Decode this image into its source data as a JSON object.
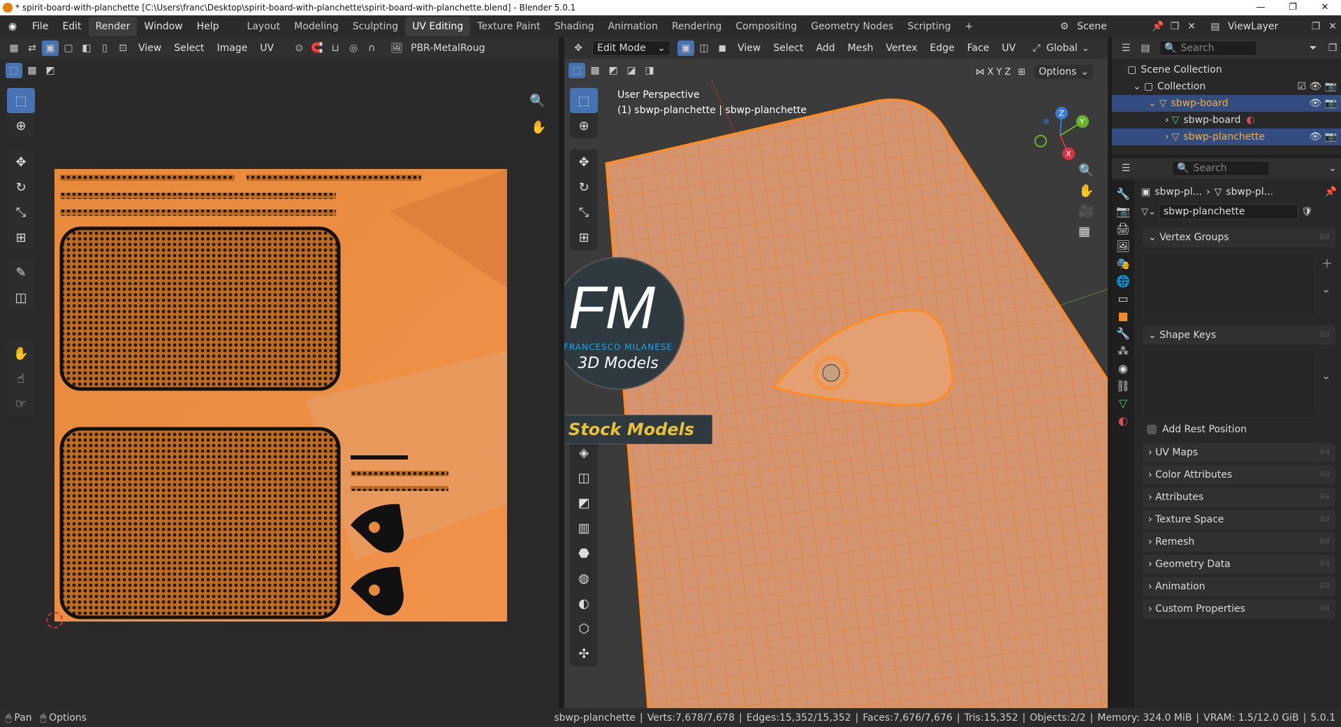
{
  "window": {
    "title": "* spirit-board-with-planchette [C:\\Users\\franc\\Desktop\\spirit-board-with-planchette\\spirit-board-with-planchette.blend] - Blender 5.0.1",
    "min": "—",
    "max": "❐",
    "close": "✕"
  },
  "menu": [
    "File",
    "Edit",
    "Render",
    "Window",
    "Help"
  ],
  "workspaces": [
    "Layout",
    "Modeling",
    "Sculpting",
    "UV Editing",
    "Texture Paint",
    "Shading",
    "Animation",
    "Rendering",
    "Compositing",
    "Geometry Nodes",
    "Scripting"
  ],
  "active_workspace": "UV Editing",
  "scene": {
    "scene_name": "Scene",
    "view_layer": "ViewLayer"
  },
  "uv_editor": {
    "menus": [
      "View",
      "Select",
      "Image",
      "UV"
    ],
    "image_name": "PBR-MetalRoug"
  },
  "viewport": {
    "mode": "Edit Mode",
    "menus": [
      "View",
      "Select",
      "Add",
      "Mesh",
      "Vertex",
      "Edge",
      "Face",
      "UV"
    ],
    "orientation": "Global",
    "options": "Options",
    "axes": [
      "X",
      "Y",
      "Z"
    ],
    "info_line1": "User Perspective",
    "info_line2": "(1) sbwp-planchette | sbwp-planchette"
  },
  "watermark": {
    "initials": "FM",
    "name": "FRANCESCO MILANESE",
    "sub": "3D Models",
    "badge": "Stock Models"
  },
  "outliner": {
    "search_placeholder": "Search",
    "scene_collection": "Scene Collection",
    "collection": "Collection",
    "items": [
      "sbwp-board",
      "sbwp-board",
      "sbwp-planchette"
    ]
  },
  "properties": {
    "search_placeholder": "Search",
    "crumb1": "sbwp-pl...",
    "crumb2": "sbwp-pl...",
    "mesh_name": "sbwp-planchette",
    "vertex_groups": "Vertex Groups",
    "shape_keys": "Shape Keys",
    "add_rest_position": "Add Rest Position",
    "sections": [
      "UV Maps",
      "Color Attributes",
      "Attributes",
      "Texture Space",
      "Remesh",
      "Geometry Data",
      "Animation",
      "Custom Properties"
    ]
  },
  "status": {
    "pan": "Pan",
    "options": "Options",
    "object": "sbwp-planchette",
    "verts": "Verts:7,678/7,678",
    "edges": "Edges:15,352/15,352",
    "faces": "Faces:7,676/7,676",
    "tris": "Tris:15,352",
    "objects": "Objects:2/2",
    "memory": "Memory: 324.0 MiB",
    "vram": "VRAM: 1.5/12.0 GiB",
    "version": "5.0.1"
  },
  "colors": {
    "accent": "#4772b3",
    "orange": "#f08a2a",
    "selected": "#ffaf29"
  }
}
